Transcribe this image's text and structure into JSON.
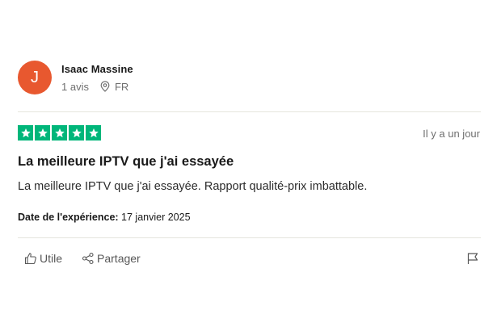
{
  "reviewer": {
    "initial": "J",
    "avatar_color": "#e8582f",
    "name": "Isaac Massine",
    "reviews_count": "1 avis",
    "country": "FR"
  },
  "review": {
    "rating": 5,
    "star_color": "#00b67a",
    "relative_date": "Il y a un jour",
    "title": "La meilleure IPTV que j'ai essayée",
    "body": "La meilleure IPTV que j'ai essayée. Rapport qualité-prix imbattable.",
    "experience_label": "Date de l'expérience:",
    "experience_date": "17 janvier 2025"
  },
  "actions": {
    "useful_label": "Utile",
    "share_label": "Partager"
  },
  "icons": {
    "location": "location-pin-icon",
    "star": "star-icon",
    "useful": "thumbs-up-icon",
    "share": "share-icon",
    "report": "flag-icon"
  }
}
